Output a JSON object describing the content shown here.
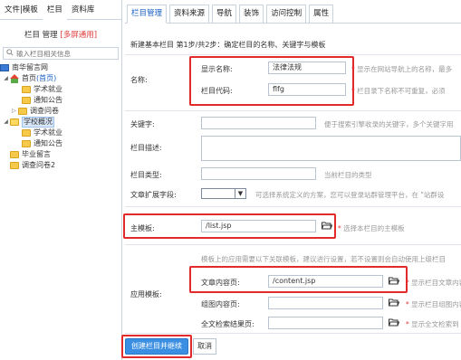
{
  "left_panel": {
    "tabs": [
      "文件|模板",
      "栏目",
      "资料库"
    ],
    "header": {
      "prefix": "栏目 管理",
      "highlight": "[多屏通用]"
    },
    "search_placeholder": "输入栏目相关信息",
    "tree": [
      {
        "label": "南华留言网",
        "icon": "monitor-icon",
        "indent": 0
      },
      {
        "label": "首页",
        "suffix": "(首页)",
        "icon": "home-icon",
        "indent": 1,
        "expanded": true
      },
      {
        "label": "学术就业",
        "icon": "folder-icon",
        "indent": 2
      },
      {
        "label": "通知公告",
        "icon": "folder-icon",
        "indent": 2
      },
      {
        "label": "调查问卷",
        "icon": "folder-icon",
        "indent": 2,
        "collapsed": true
      },
      {
        "label": "学校概况",
        "icon": "folder-open-icon",
        "indent": 1,
        "expanded": true,
        "selected": true
      },
      {
        "label": "学术就业",
        "icon": "folder-icon",
        "indent": 2
      },
      {
        "label": "通知公告",
        "icon": "folder-icon",
        "indent": 2
      },
      {
        "label": "毕业留言",
        "icon": "folder-icon",
        "indent": 1
      },
      {
        "label": "调查问卷2",
        "icon": "folder-icon",
        "indent": 1
      }
    ]
  },
  "right_panel": {
    "tabs": [
      "栏目管理",
      "资料来源",
      "导航",
      "装饰",
      "访问控制",
      "属性"
    ],
    "step_text": "新建基本栏目 第1步/共2步：确定栏目的名称、关键字与模板",
    "name_section": {
      "label": "名称:",
      "display_name_label": "显示名称:",
      "display_name_value": "法律法规",
      "display_name_hint": "显示在网站导航上的名称，最多",
      "code_label": "栏目代码:",
      "code_value": "flfg",
      "code_hint": "栏目录下名称不可重复，必须"
    },
    "keywords": {
      "label": "关键字:",
      "value": "",
      "hint": "便于搜索引擎收录的关键字，多个关键字用"
    },
    "description": {
      "label": "栏目描述:",
      "value": ""
    },
    "type": {
      "label": "栏目类型:",
      "value": "",
      "hint": "当前栏目的类型"
    },
    "ext_fields": {
      "label": "文章扩展字段:",
      "value": "",
      "hint": "可选择系统定义的方案，您可以登录站群管理平台，在 \"站群设"
    },
    "main_template": {
      "label": "主模板:",
      "value": "/list.jsp",
      "hint": "选择本栏目的主模板"
    },
    "app_template": {
      "label": "应用模板:",
      "hint": "模板上的应用需要以下关联模板，建议进行设置，若不设置则会自动使用上级栏目",
      "rows": [
        {
          "label": "文章内容页:",
          "value": "/content.jsp",
          "hint": "显示栏目文章内容"
        },
        {
          "label": "组图内容页:",
          "value": "",
          "hint": "显示栏目组图内容"
        },
        {
          "label": "全文检索结果页:",
          "value": "",
          "hint": "显示全文检索到"
        }
      ]
    },
    "buttons": {
      "create": "创建栏目并继续",
      "cancel": "取消"
    }
  },
  "colors": {
    "highlight_box": "#e32a2a",
    "primary_button": "#3b8fe3",
    "selected_tab": "#1b5fc5",
    "star": "#e23b3b"
  }
}
